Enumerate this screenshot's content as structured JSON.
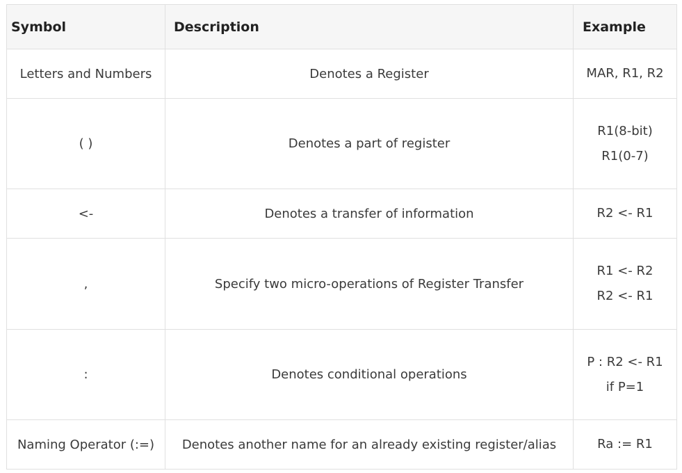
{
  "table": {
    "headers": {
      "symbol": "Symbol",
      "description": "Description",
      "example": "Example"
    },
    "rows": [
      {
        "symbol": "Letters and Numbers",
        "description": "Denotes a Register",
        "example": [
          "MAR, R1, R2"
        ]
      },
      {
        "symbol": "( )",
        "description": "Denotes a part of register",
        "example": [
          "R1(8-bit)",
          "R1(0-7)"
        ]
      },
      {
        "symbol": "<-",
        "description": "Denotes a transfer of information",
        "example": [
          "R2 <- R1"
        ]
      },
      {
        "symbol": ",",
        "description": "Specify two micro-operations of Register Transfer",
        "example": [
          "R1 <- R2",
          "R2 <- R1"
        ]
      },
      {
        "symbol": ":",
        "description": "Denotes conditional operations",
        "example": [
          "P : R2 <- R1",
          "if P=1"
        ]
      },
      {
        "symbol": "Naming Operator (:=)",
        "description": "Denotes another name for an already existing register/alias",
        "example": [
          "Ra := R1"
        ]
      }
    ]
  }
}
